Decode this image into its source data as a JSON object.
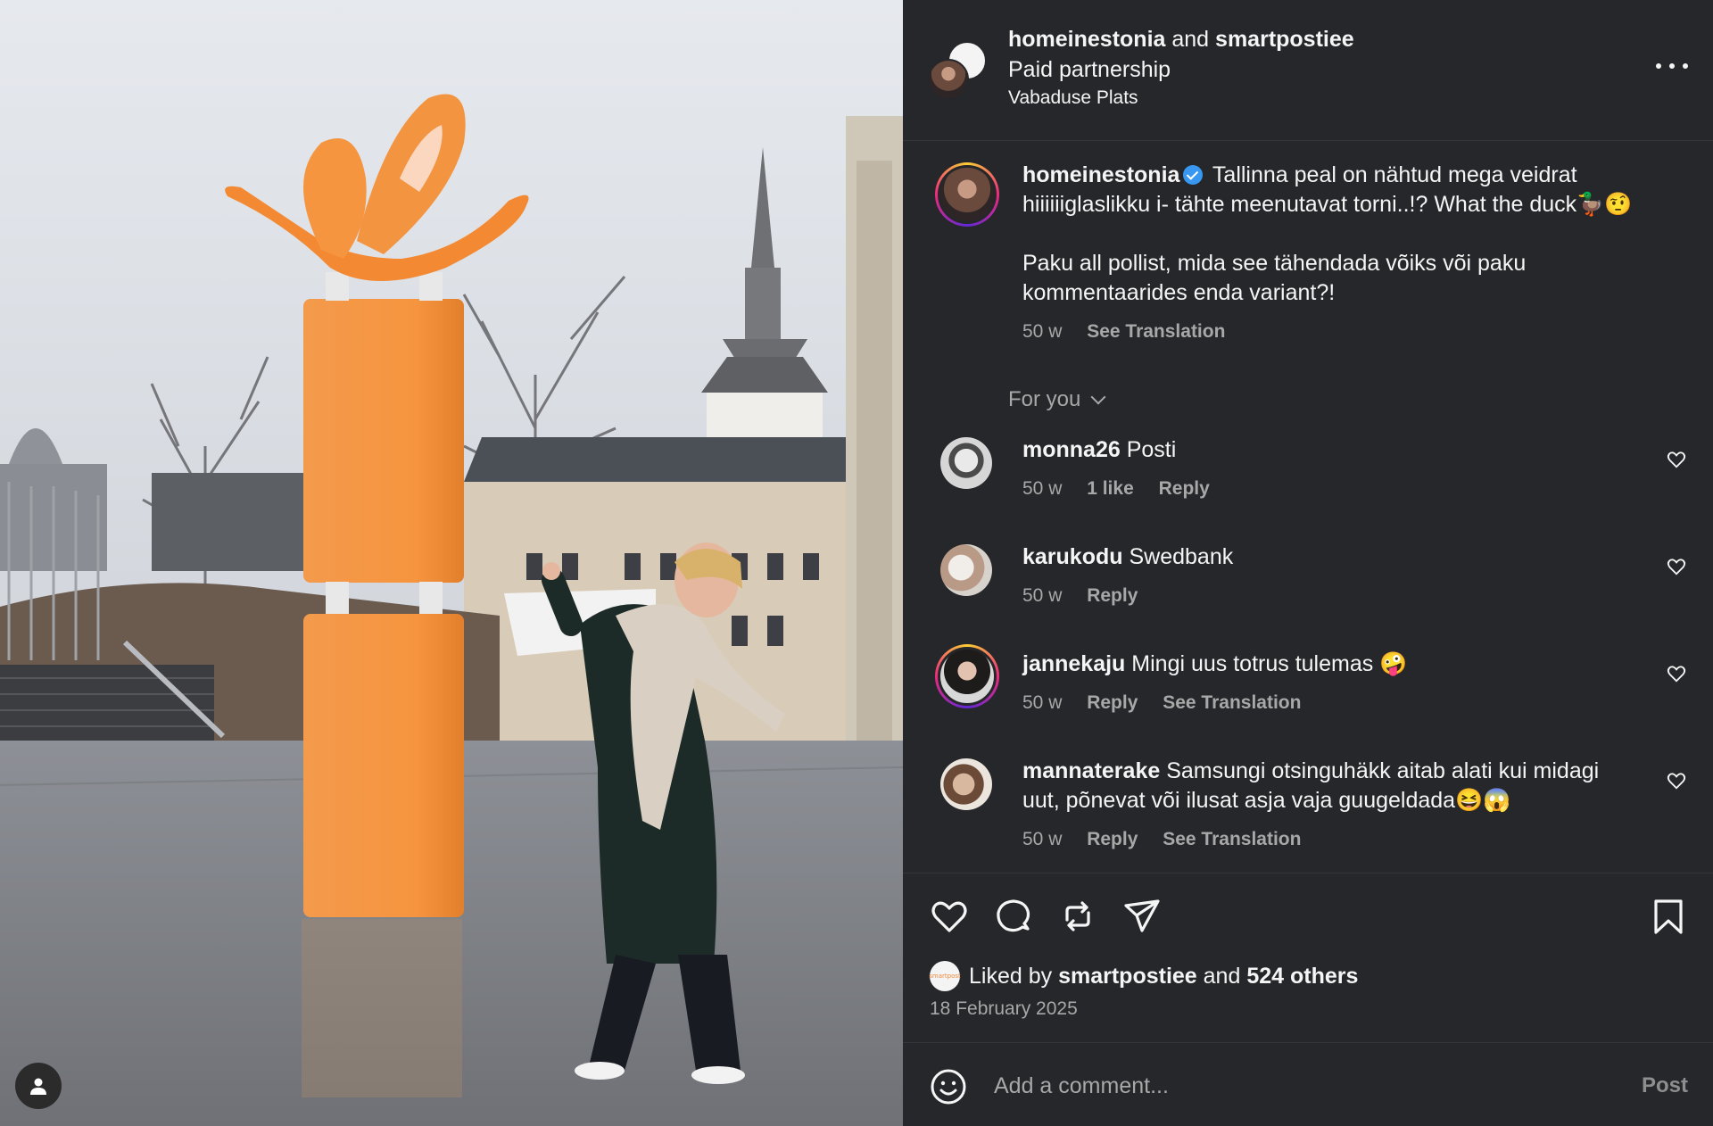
{
  "header": {
    "account1": "homeinestonia",
    "joiner": "and",
    "account2": "smartpostiee",
    "subtitle": "Paid partnership",
    "location": "Vabaduse Plats"
  },
  "caption": {
    "username": "homeinestonia",
    "text_line1": "Tallinna peal on nähtud mega veidrat",
    "text_line2": "hiiiiiiglaslikku i- tähte meenutavat torni..!? What the duck🦆🤨",
    "text_line3": "Paku all pollist, mida see tähendada võiks või paku",
    "text_line4": "kommentaarides enda variant?!",
    "age": "50 w",
    "see_translation": "See Translation"
  },
  "for_you": "For you",
  "comments": [
    {
      "username": "monna26",
      "text": "Posti",
      "age": "50 w",
      "likes": "1 like",
      "reply": "Reply"
    },
    {
      "username": "karukodu",
      "text": "Swedbank",
      "age": "50 w",
      "reply": "Reply"
    },
    {
      "username": "jannekaju",
      "text": "Mingi uus totrus tulemas 🤪",
      "age": "50 w",
      "reply": "Reply",
      "see_translation": "See Translation"
    },
    {
      "username": "mannaterake",
      "text_line1": "Samsungi otsinguhäkk aitab alati kui midagi",
      "text_line2": "uut, põnevat või ilusat asja vaja guugeldada😆😱",
      "age": "50 w",
      "reply": "Reply",
      "see_translation": "See Translation"
    }
  ],
  "likes": {
    "prefix": "Liked by",
    "user": "smartpostiee",
    "joiner": "and",
    "others": "524 others",
    "avatar_text": "smartpost"
  },
  "date": "18 February 2025",
  "composer": {
    "placeholder": "Add a comment...",
    "post_label": "Post"
  },
  "icons": {
    "like": "heart-icon",
    "comment": "comment-icon",
    "repost": "repost-icon",
    "share": "share-icon",
    "save": "bookmark-icon",
    "emoji": "emoji-icon",
    "more": "more-icon",
    "tags": "user-tag-icon"
  },
  "colors": {
    "panel_bg": "#26272b",
    "text": "#f5f5f5",
    "muted": "#a8a8a8",
    "verified": "#3897f0",
    "sculpture_orange": "#f6953f"
  }
}
